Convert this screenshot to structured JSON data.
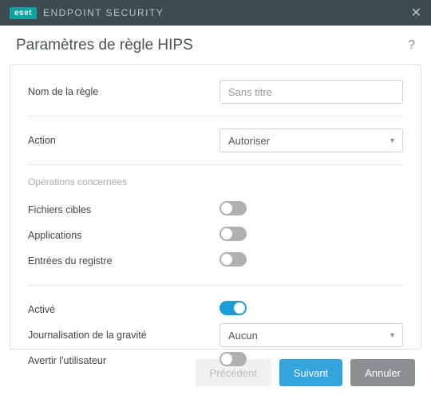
{
  "header": {
    "brand": "eset",
    "product": "ENDPOINT SECURITY"
  },
  "page": {
    "title": "Paramètres de règle HIPS"
  },
  "fields": {
    "rule_name_label": "Nom de la règle",
    "rule_name_placeholder": "Sans titre",
    "action_label": "Action",
    "action_value": "Autoriser",
    "operations_section": "Opérations concernées",
    "target_files_label": "Fichiers cibles",
    "target_files_on": false,
    "applications_label": "Applications",
    "applications_on": false,
    "registry_label": "Entrées du registre",
    "registry_on": false,
    "enabled_label": "Activé",
    "enabled_on": true,
    "severity_label": "Journalisation de la gravité",
    "severity_value": "Aucun",
    "notify_label": "Avertir l'utilisateur",
    "notify_on": false
  },
  "footer": {
    "prev": "Précédent",
    "next": "Suivant",
    "cancel": "Annuler"
  }
}
